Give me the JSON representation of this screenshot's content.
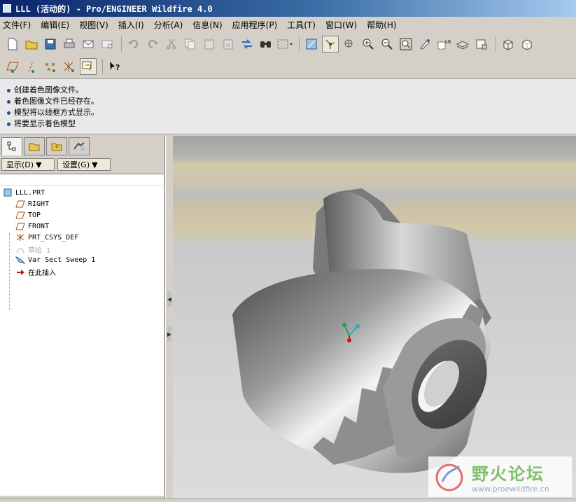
{
  "window": {
    "title": "LLL (活动的) - Pro/ENGINEER Wildfire 4.0"
  },
  "menubar": {
    "items": [
      "文件(F)",
      "编辑(E)",
      "视图(V)",
      "插入(I)",
      "分析(A)",
      "信息(N)",
      "应用程序(P)",
      "工具(T)",
      "窗口(W)",
      "帮助(H)"
    ]
  },
  "toolbar": {
    "row1_icons": [
      "new-icon",
      "open-icon",
      "save-icon",
      "print-icon",
      "email-icon",
      "email-attach-icon",
      "undo-icon",
      "redo-icon",
      "cut-icon",
      "copy-icon",
      "paste-icon",
      "paste-special-icon",
      "regenerate-icon",
      "find-icon",
      "select-box-icon",
      "sketch-view-icon",
      "spin-center-icon",
      "orient-icon",
      "zoom-in-icon",
      "zoom-out-icon",
      "refit-icon",
      "repaint-icon",
      "view-manager-icon",
      "layers-icon",
      "model-tree-icon",
      "shading-icon",
      "hidden-line-icon"
    ],
    "row2_icons": [
      "datum-plane-icon",
      "datum-axis-icon",
      "datum-point-icon",
      "coord-sys-icon",
      "annotation-icon",
      "whats-this-icon"
    ]
  },
  "messages": [
    "创建着色图像文件。",
    "着色图像文件已经存在。",
    "模型将以线框方式显示。",
    "将要显示着色模型"
  ],
  "navigator": {
    "tabs": [
      "model-tree-tab-icon",
      "folder-browser-tab-icon",
      "favorites-tab-icon",
      "connections-tab-icon"
    ],
    "show_label": "显示(D)",
    "settings_label": "设置(G)"
  },
  "model_tree": {
    "root": "LLL.PRT",
    "items": [
      {
        "label": "RIGHT",
        "icon": "datum-plane-icon",
        "dim": false
      },
      {
        "label": "TOP",
        "icon": "datum-plane-icon",
        "dim": false
      },
      {
        "label": "FRONT",
        "icon": "datum-plane-icon",
        "dim": false
      },
      {
        "label": "PRT_CSYS_DEF",
        "icon": "coord-sys-icon",
        "dim": false
      },
      {
        "label": "草绘 1",
        "icon": "sketch-icon",
        "dim": true
      },
      {
        "label": "Var Sect Sweep 1",
        "icon": "sweep-icon",
        "dim": false
      },
      {
        "label": "在此插入",
        "icon": "insert-here-arrow-icon",
        "dim": false
      }
    ]
  },
  "watermark": {
    "title": "野火论坛",
    "url": "www.proewildfire.cn"
  }
}
